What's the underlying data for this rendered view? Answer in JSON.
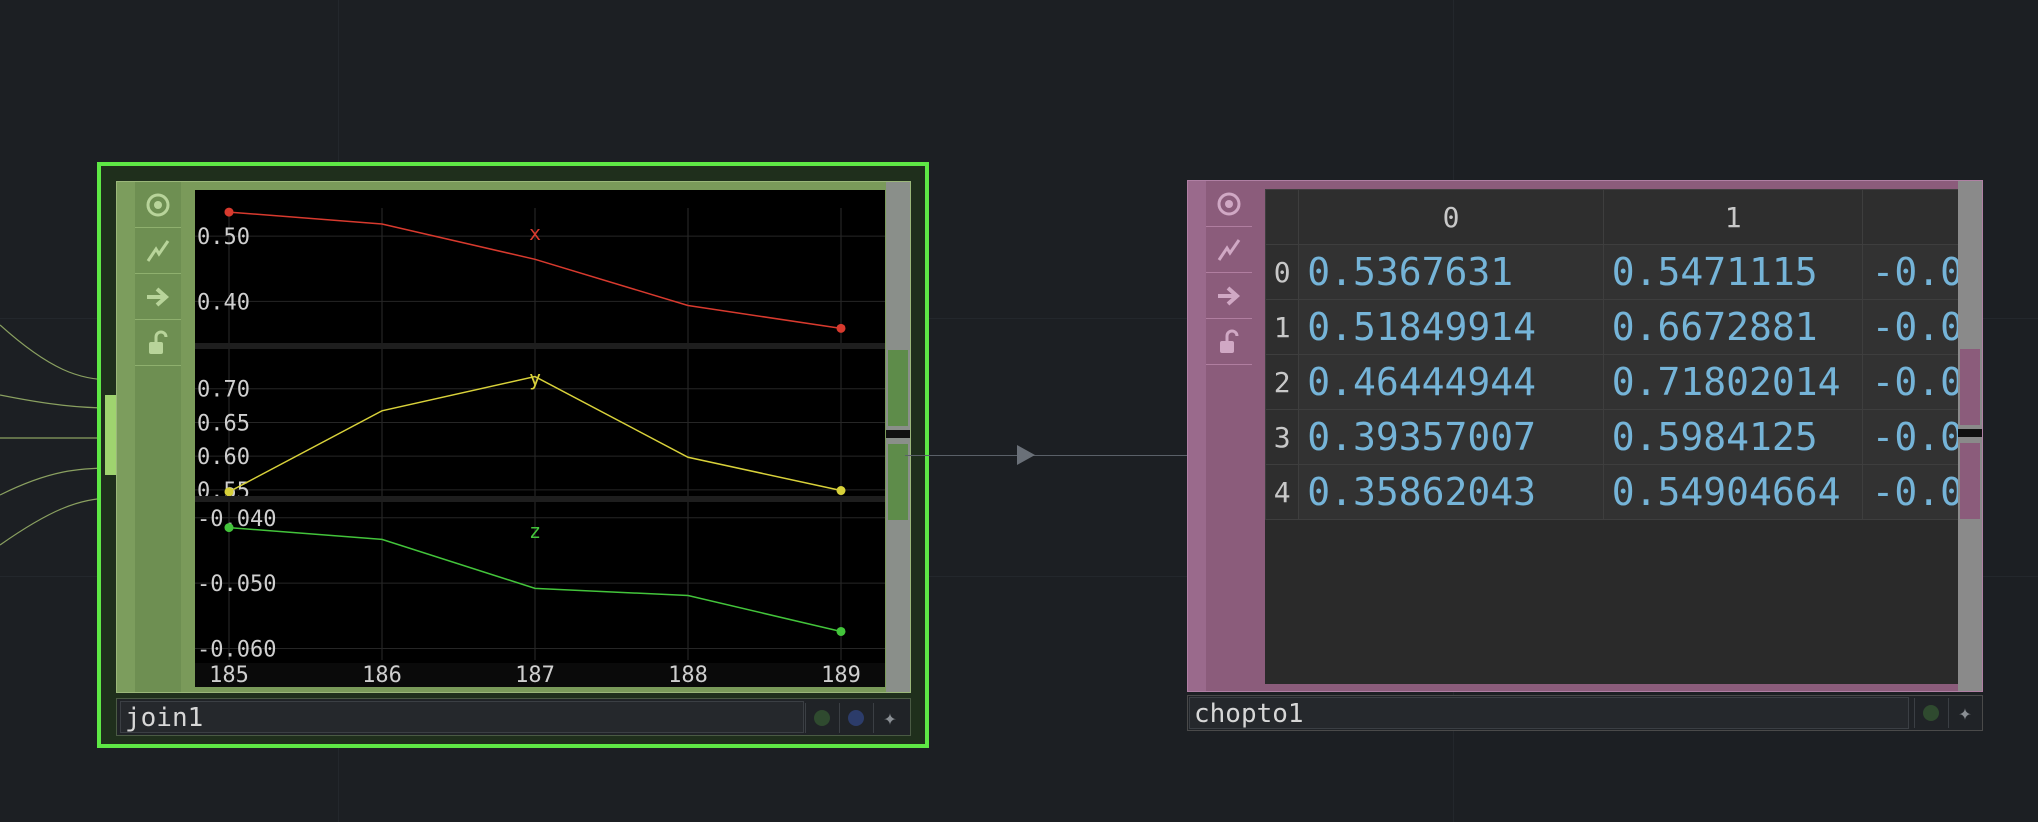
{
  "join_node": {
    "name": "join1",
    "side_icons": [
      "viewer-icon",
      "bypass-icon",
      "export-icon",
      "lock-icon"
    ],
    "chart_data": {
      "type": "line",
      "x": [
        185,
        186,
        187,
        188,
        189
      ],
      "x_ticks": [
        "185",
        "186",
        "187",
        "188",
        "189"
      ],
      "channels": [
        {
          "name": "x",
          "color": "#d83a2e",
          "values": [
            0.5367631,
            0.51849914,
            0.46444944,
            0.39357007,
            0.35862043
          ],
          "ylim": [
            0.33,
            0.54
          ],
          "tick_values": [
            0.5,
            0.4
          ],
          "tick_labels": [
            "0.50",
            "0.40"
          ]
        },
        {
          "name": "y",
          "color": "#d8d13a",
          "values": [
            0.5471115,
            0.6672881,
            0.71802014,
            0.5984125,
            0.54904664
          ],
          "ylim": [
            0.535,
            0.75
          ],
          "tick_values": [
            0.7,
            0.65,
            0.6,
            0.55
          ],
          "tick_labels": [
            "0.70",
            "0.65",
            "0.60",
            "0.55"
          ]
        },
        {
          "name": "z",
          "color": "#43c43b",
          "values": [
            -0.0415,
            -0.0433,
            -0.0508,
            -0.0519,
            -0.0574
          ],
          "ylim": [
            -0.061,
            -0.0385
          ],
          "tick_values": [
            -0.04,
            -0.05,
            -0.06
          ],
          "tick_labels": [
            "-0.040",
            "-0.050",
            "-0.060"
          ]
        }
      ]
    }
  },
  "chopto_node": {
    "name": "chopto1",
    "side_icons": [
      "viewer-icon",
      "bypass-icon",
      "export-icon",
      "lock-icon"
    ],
    "columns": [
      "",
      "0",
      "1",
      ""
    ],
    "rows": [
      {
        "index": "0",
        "c0": "0.5367631",
        "c1": "0.5471115",
        "c2": "-0.0"
      },
      {
        "index": "1",
        "c0": "0.51849914",
        "c1": "0.6672881",
        "c2": "-0.0"
      },
      {
        "index": "2",
        "c0": "0.46444944",
        "c1": "0.71802014",
        "c2": "-0.0"
      },
      {
        "index": "3",
        "c0": "0.39357007",
        "c1": "0.5984125",
        "c2": "-0.0"
      },
      {
        "index": "4",
        "c0": "0.35862043",
        "c1": "0.54904664",
        "c2": "-0.0"
      }
    ]
  },
  "colors": {
    "join_border": "#5ee845",
    "join_body": "#7a9a5a",
    "chopto_body": "#8b5c7b",
    "table_value": "#75b4d8",
    "background": "#1c1f23"
  }
}
